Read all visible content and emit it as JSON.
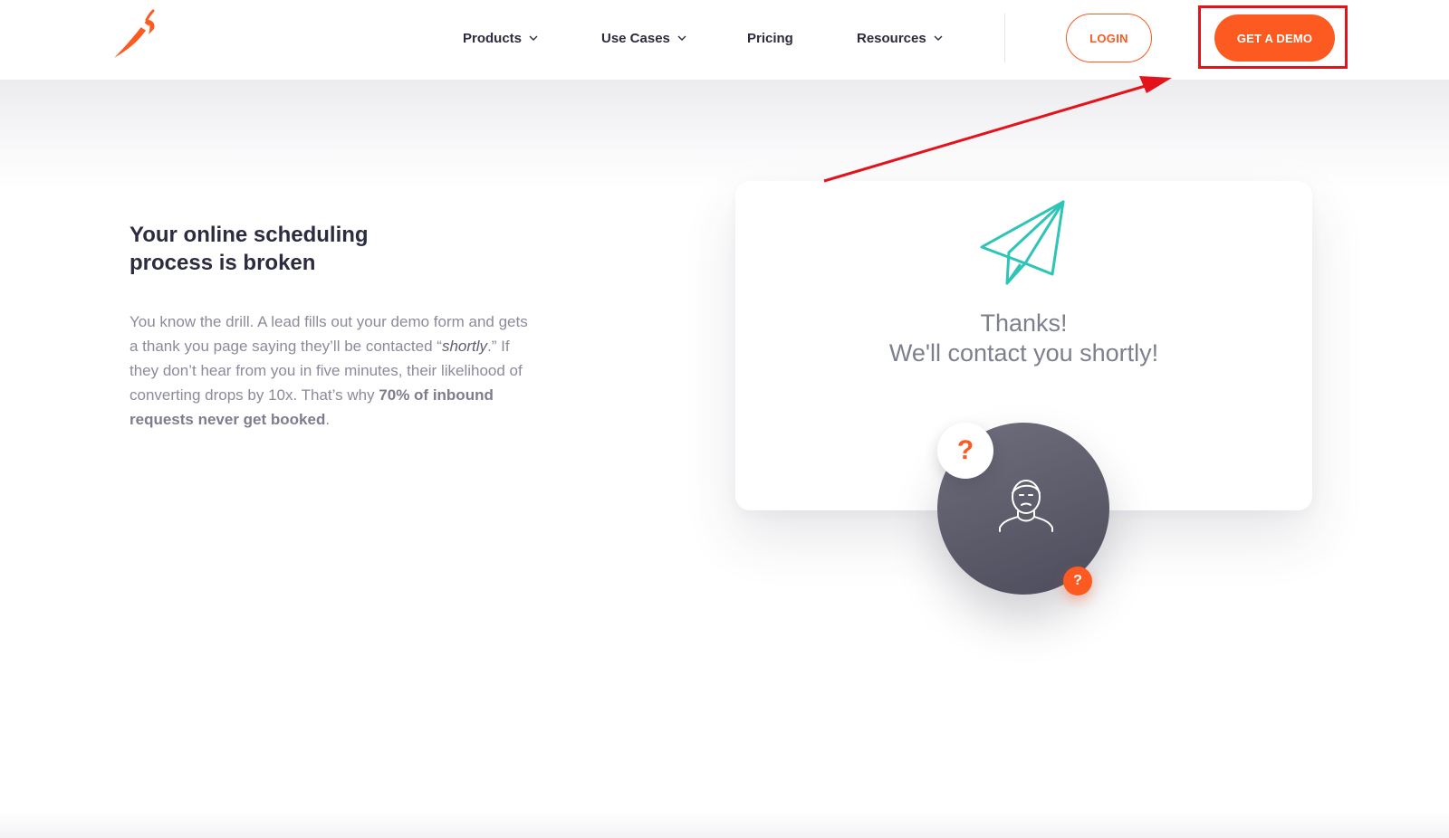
{
  "nav": {
    "items": [
      {
        "label": "Products",
        "has_dropdown": true
      },
      {
        "label": "Use Cases",
        "has_dropdown": true
      },
      {
        "label": "Pricing",
        "has_dropdown": false
      },
      {
        "label": "Resources",
        "has_dropdown": true
      }
    ],
    "login_label": "LOGIN",
    "demo_label": "GET A DEMO"
  },
  "logo": {
    "icon": "chili-pepper-icon",
    "color": "#fc5a20"
  },
  "hero": {
    "headline": "Your online scheduling process is broken",
    "body_part1": "You know the drill. A lead fills out your demo form and gets a thank you page saying they’ll be contacted “",
    "body_emphasis": "shortly",
    "body_part2": ".” If they don’t hear from you in five minutes, their likelihood of converting drops by 10x. That’s why ",
    "body_strong": "70% of inbound requests never get booked",
    "body_part3": "."
  },
  "card": {
    "icon": "paper-plane-icon",
    "title": "Thanks!",
    "subtitle": "We'll contact you shortly!",
    "question_mark_large": "?",
    "question_mark_small": "?"
  },
  "colors": {
    "accent": "#fc5a20",
    "teal": "#2ec4b6",
    "annotation": "#e4121b"
  }
}
